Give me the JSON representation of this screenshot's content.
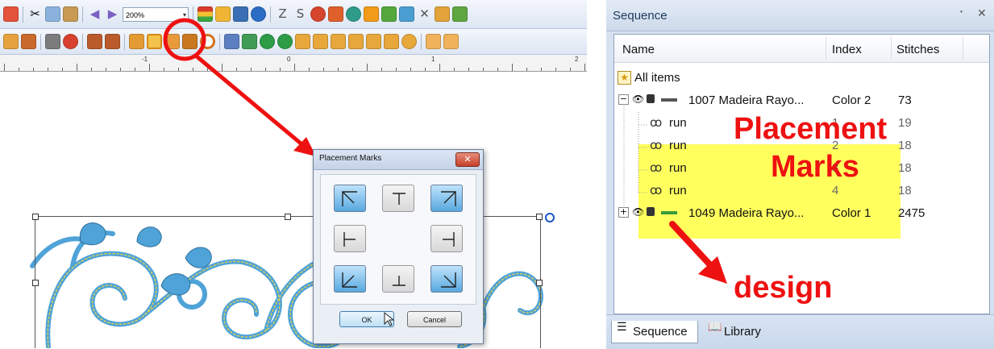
{
  "toolbar": {
    "zoom_value": "200%"
  },
  "ruler": {
    "labels": [
      "-1",
      "0",
      "1",
      "2"
    ]
  },
  "dialog": {
    "title": "Placement Marks",
    "close_glyph": "✕",
    "ok_label": "OK",
    "cancel_label": "Cancel",
    "marks": [
      {
        "name": "top-left",
        "selected": true
      },
      {
        "name": "top-center",
        "selected": false
      },
      {
        "name": "top-right",
        "selected": true
      },
      {
        "name": "middle-left",
        "selected": false
      },
      {
        "name": "middle-right",
        "selected": false
      },
      {
        "name": "bottom-left",
        "selected": true
      },
      {
        "name": "bottom-center",
        "selected": false
      },
      {
        "name": "bottom-right",
        "selected": true
      }
    ]
  },
  "sequence_panel": {
    "title": "Sequence",
    "pin_glyph": "ᐩ",
    "close_glyph": "✕",
    "columns": [
      "Name",
      "Index",
      "Stitches"
    ],
    "all_items_label": "All items",
    "rows": [
      {
        "expander": "−",
        "name": "1007 Madeira Rayo...",
        "index": "Color 2",
        "stitches": "73"
      },
      {
        "name": "run",
        "index": "1",
        "stitches": "19"
      },
      {
        "name": "run",
        "index": "2",
        "stitches": "18"
      },
      {
        "name": "run",
        "index": "3",
        "stitches": "18"
      },
      {
        "name": "run",
        "index": "4",
        "stitches": "18"
      },
      {
        "expander": "+",
        "name": "1049 Madeira Rayo...",
        "index": "Color 1",
        "stitches": "2475"
      }
    ],
    "tabs": [
      "Sequence",
      "Library"
    ]
  },
  "annotations": {
    "placement_line1": "Placement",
    "placement_line2": "Marks",
    "design": "design"
  },
  "colors": {
    "annotation_red": "#ee1111",
    "highlight_yellow": "#ffff3b",
    "thread_blue": "#4fa3d8",
    "thread_yellow": "#e6d24a"
  }
}
